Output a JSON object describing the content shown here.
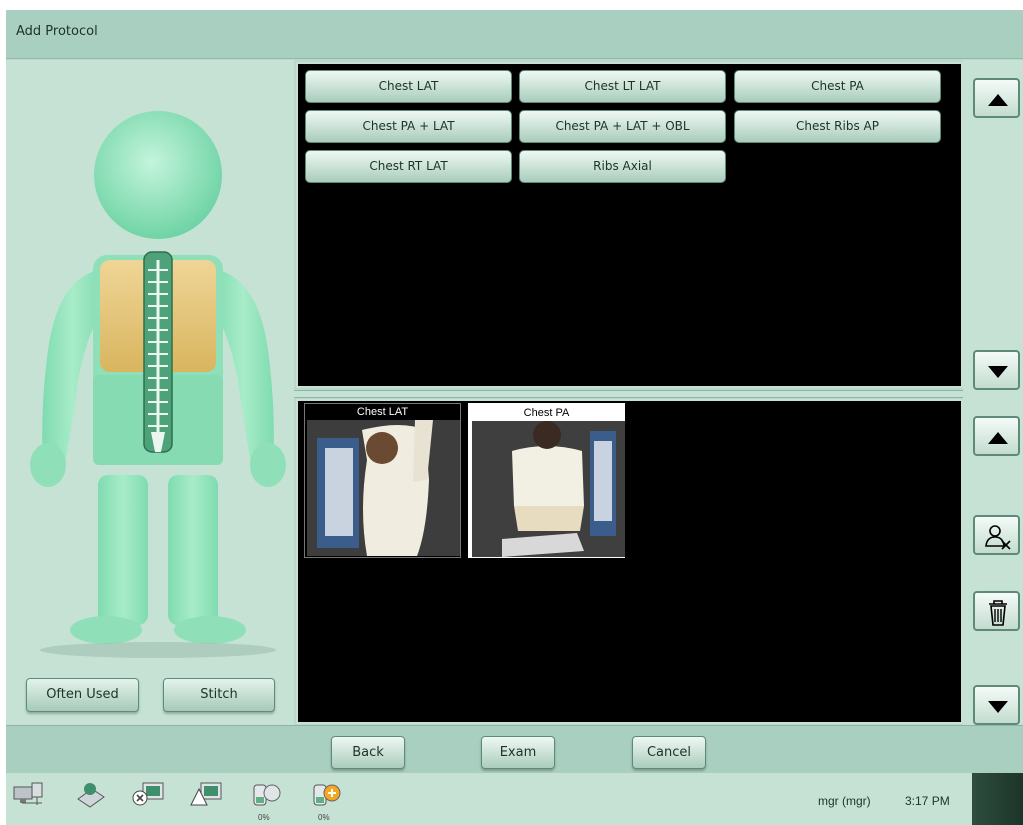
{
  "window": {
    "title": "Add Protocol"
  },
  "left_panel": {
    "often_used_label": "Often Used",
    "stitch_label": "Stitch"
  },
  "protocols": [
    "Chest LAT",
    "Chest LT LAT",
    "Chest PA",
    "Chest PA + LAT",
    "Chest PA + LAT + OBL",
    "Chest Ribs AP",
    "Chest RT LAT",
    "Ribs Axial"
  ],
  "selected_protocols": [
    {
      "label": "Chest LAT",
      "selected": false
    },
    {
      "label": "Chest PA",
      "selected": true
    }
  ],
  "right_controls": {
    "icons": [
      "arrow-up-icon",
      "arrow-down-icon",
      "arrow-up-icon",
      "user-edit-icon",
      "trash-icon",
      "arrow-down-icon"
    ]
  },
  "actions": {
    "back_label": "Back",
    "exam_label": "Exam",
    "cancel_label": "Cancel"
  },
  "taskbar": {
    "icons": [
      "network-icon",
      "scanner-icon",
      "monitor-error-icon",
      "monitor-warning-icon",
      "detector-battery-icon",
      "detector-battery-icon"
    ],
    "pct_1": "0%",
    "pct_2": "0%",
    "user": "mgr (mgr)",
    "time": "3:17 PM"
  },
  "colors": {
    "panel_green": "#c5e2d5",
    "title_green": "#a9cfc0",
    "body_mint": "#8fe0b8",
    "chest_gold": "#e3c37a"
  }
}
